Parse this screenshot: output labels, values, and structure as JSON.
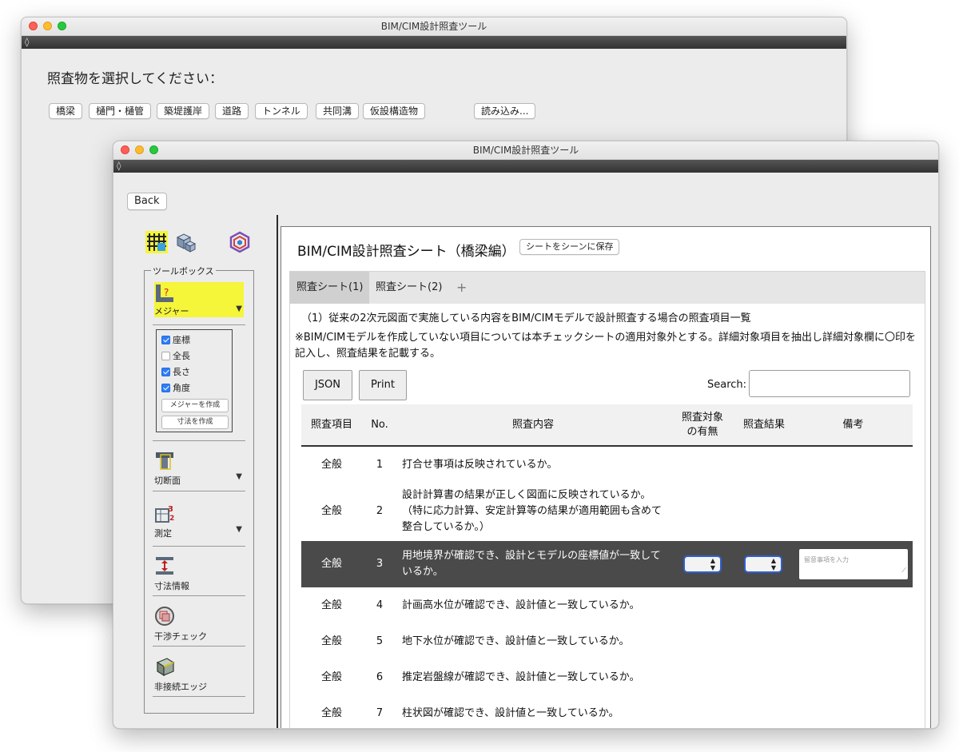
{
  "window_title": "BIM/CIM設計照査ツール",
  "menu_glyph": "◊",
  "select_window": {
    "prompt": "照査物を選択してください：",
    "choices": [
      "橋梁",
      "樋門・樋管",
      "築堤護岸",
      "道路",
      "トンネル",
      "共同溝",
      "仮設構造物"
    ],
    "load_button": "読み込み..."
  },
  "sheet_window": {
    "back_label": "Back",
    "toolbox": {
      "legend": "ツールボックス",
      "tools": [
        "メジャー",
        "切断面",
        "測定",
        "寸法情報",
        "干渉チェック",
        "非接続エッジ"
      ],
      "dropdown_arrow": "▼",
      "checks": [
        {
          "label": "座標",
          "checked": true
        },
        {
          "label": "全長",
          "checked": false
        },
        {
          "label": "長さ",
          "checked": true
        },
        {
          "label": "角度",
          "checked": true
        }
      ],
      "make_measure": "メジャーを作成",
      "make_dimension": "寸法を作成"
    },
    "sheet": {
      "title": "BIM/CIM設計照査シート（橋梁編）",
      "save_button": "シートをシーンに保存",
      "tabs": [
        "照査シート(1)",
        "照査シート(2)"
      ],
      "add_tab": "+",
      "description1": "（1）従来の2次元図面で実施している内容をBIM/CIMモデルで設計照査する場合の照査項目一覧",
      "description2": "※BIM/CIMモデルを作成していない項目については本チェックシートの適用対象外とする。詳細対象項目を抽出し詳細対象欄に〇印を記入し、照査結果を記載する。",
      "json_button": "JSON",
      "print_button": "Print",
      "search_label": "Search:",
      "columns": [
        "照査項目",
        "No.",
        "照査内容",
        "照査対象\nの有無",
        "照査結果",
        "備考"
      ],
      "memo_placeholder": "留意事項を入力",
      "rows": [
        {
          "category": "全般",
          "no": "1",
          "content": "打合せ事項は反映されているか。"
        },
        {
          "category": "全般",
          "no": "2",
          "content": "設計計算書の結果が正しく図面に反映されているか。（特に応力計算、安定計算等の結果が適用範囲も含めて整合しているか。）"
        },
        {
          "category": "全般",
          "no": "3",
          "content": "用地境界が確認でき、設計とモデルの座標値が一致しているか。"
        },
        {
          "category": "全般",
          "no": "4",
          "content": "計画高水位が確認でき、設計値と一致しているか。"
        },
        {
          "category": "全般",
          "no": "5",
          "content": "地下水位が確認でき、設計値と一致しているか。"
        },
        {
          "category": "全般",
          "no": "6",
          "content": "推定岩盤線が確認でき、設計値と一致しているか。"
        },
        {
          "category": "全般",
          "no": "7",
          "content": "柱状図が確認でき、設計値と一致しているか。"
        }
      ]
    }
  }
}
